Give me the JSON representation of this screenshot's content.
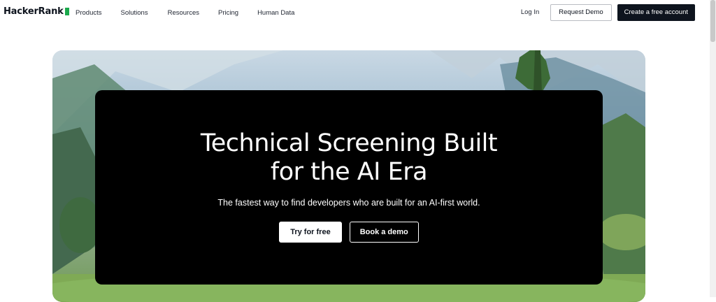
{
  "brand": {
    "name": "HackerRank",
    "mark_color": "#1ba94c"
  },
  "nav": {
    "links": [
      "Products",
      "Solutions",
      "Resources",
      "Pricing",
      "Human Data"
    ],
    "login": "Log In",
    "request_demo": "Request Demo",
    "create_account": "Create a free account"
  },
  "hero": {
    "headline": "Technical Screening Built for the AI Era",
    "subhead": "The fastest way to find developers who are built for an AI-first world.",
    "cta_primary": "Try for free",
    "cta_secondary": "Book a demo"
  },
  "colors": {
    "dark": "#0e141e",
    "card": "#000000",
    "accent": "#1ba94c"
  }
}
